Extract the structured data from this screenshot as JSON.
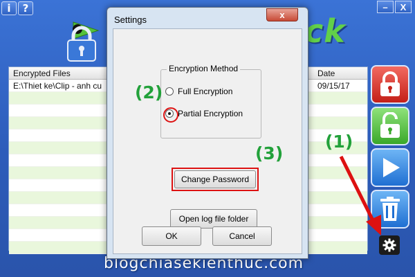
{
  "app": {
    "titlebar_buttons": [
      {
        "label": "i",
        "icon": "info-icon"
      },
      {
        "label": "?",
        "icon": "help-icon"
      }
    ],
    "window_controls": {
      "minimize": "–",
      "close": "X"
    },
    "logo_text": "ck",
    "file_list": {
      "columns": [
        "Encrypted Files",
        "Date"
      ],
      "rows": [
        {
          "file": "E:\\Thiet ke\\Clip - anh cu",
          "date": "09/15/17"
        },
        {
          "file": "",
          "date": ""
        },
        {
          "file": "",
          "date": ""
        },
        {
          "file": "",
          "date": ""
        },
        {
          "file": "",
          "date": ""
        },
        {
          "file": "",
          "date": ""
        },
        {
          "file": "",
          "date": ""
        },
        {
          "file": "",
          "date": ""
        },
        {
          "file": "",
          "date": ""
        },
        {
          "file": "",
          "date": ""
        },
        {
          "file": "",
          "date": ""
        },
        {
          "file": "",
          "date": ""
        },
        {
          "file": "",
          "date": ""
        },
        {
          "file": "",
          "date": ""
        }
      ]
    },
    "side_buttons": [
      {
        "name": "encrypt",
        "icon": "locked-padlock-icon",
        "color": "#d7261e"
      },
      {
        "name": "decrypt",
        "icon": "unlocked-padlock-icon",
        "color": "#4cb73a"
      },
      {
        "name": "play",
        "icon": "play-icon",
        "color": "#2b83e0"
      },
      {
        "name": "delete",
        "icon": "trash-icon",
        "color": "#2b83e0"
      }
    ],
    "settings_button_icon": "gear-icon"
  },
  "dialog": {
    "title": "Settings",
    "close_label": "x",
    "group_title": "Encryption Method",
    "options": [
      {
        "label": "Full Encryption",
        "checked": false
      },
      {
        "label": "Partial Encryption",
        "checked": true
      }
    ],
    "change_password_label": "Change Password",
    "open_log_label": "Open log file folder",
    "ok_label": "OK",
    "cancel_label": "Cancel"
  },
  "annotations": {
    "step1": "(1)",
    "step2": "(2)",
    "step3": "(3)",
    "highlight_color": "#dd1111",
    "annotation_color": "#22a13a"
  },
  "watermark": "blogchiasekienthuc.com"
}
